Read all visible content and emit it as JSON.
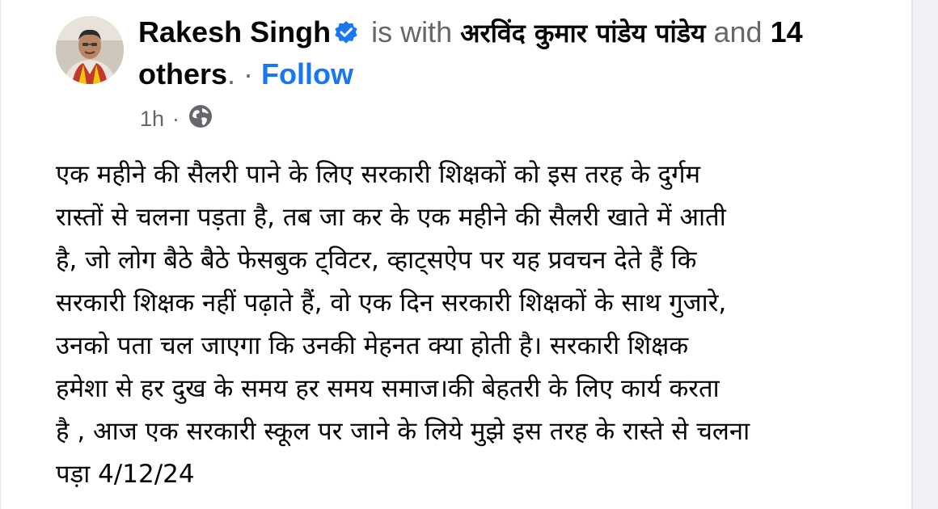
{
  "post": {
    "author": "Rakesh Singh",
    "with_text": " is with ",
    "tagged_person": "अरविंद कुमार पांडेय पांडेय",
    "and_text": " and ",
    "others_prefix": "14",
    "others_suffix": "others",
    "period": ".",
    "separator": " · ",
    "follow_label": "Follow",
    "time": "1h",
    "time_separator": "·",
    "body_text": "एक महीने की सैलरी पाने के लिए सरकारी शिक्षकों को इस तरह के दुर्गम\nरास्तों से चलना पड़ता है, तब जा कर के एक महीने की सैलरी खाते में आती\nहै, जो लोग बैठे बैठे फेसबुक ट्विटर, व्हाट्सऐप पर यह प्रवचन देते हैं कि\nसरकारी शिक्षक नहीं पढ़ाते हैं, वो एक दिन सरकारी शिक्षकों के साथ गुजारे,\nउनको पता चल जाएगा कि उनकी मेहनत क्या होती है। सरकारी शिक्षक\nहमेशा से हर दुख के समय  हर समय समाज।की बेहतरी के लिए कार्य करता\nहै , आज एक सरकारी स्कूल पर जाने के लिये मुझे इस तरह के रास्ते से चलना\nपड़ा 4/12/24"
  },
  "icons": {
    "verified": "verified-badge-icon",
    "privacy": "globe-icon"
  },
  "colors": {
    "link_blue": "#1877f2",
    "text_primary": "#050505",
    "text_secondary": "#65676b"
  }
}
